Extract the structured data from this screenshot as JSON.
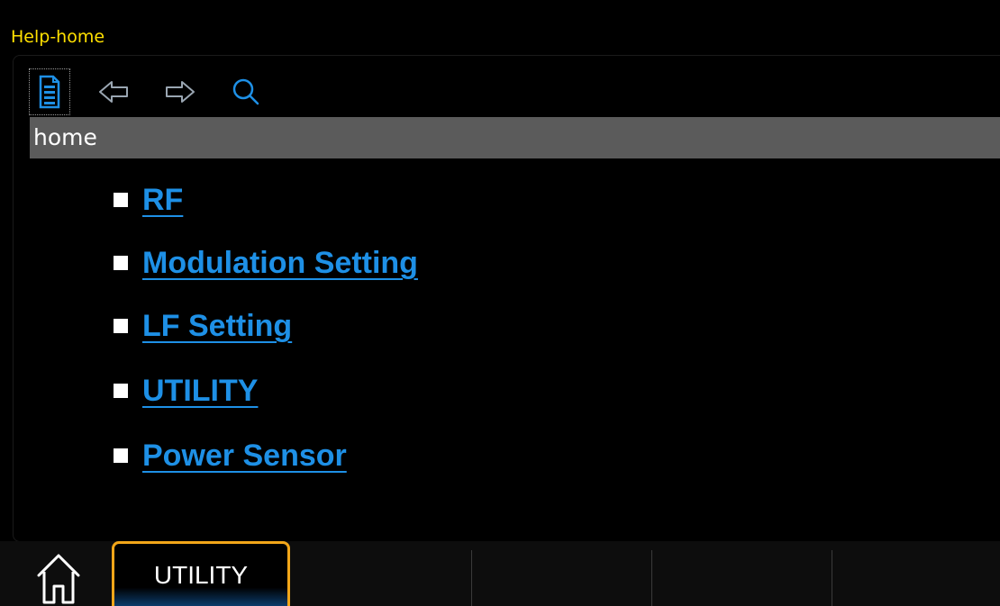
{
  "window": {
    "title": "Help-home"
  },
  "toolbar": {
    "buttons": [
      {
        "name": "contents",
        "icon": "document-list-icon"
      },
      {
        "name": "back",
        "icon": "back-arrow-icon"
      },
      {
        "name": "forward",
        "icon": "forward-arrow-icon"
      },
      {
        "name": "search",
        "icon": "search-icon"
      }
    ]
  },
  "breadcrumb": {
    "text": "home"
  },
  "topics": [
    {
      "label": "RF"
    },
    {
      "label": "Modulation Setting"
    },
    {
      "label": "LF Setting"
    },
    {
      "label": "UTILITY"
    },
    {
      "label": "Power Sensor"
    }
  ],
  "bottom_bar": {
    "home_icon": "home-icon",
    "softkeys": [
      {
        "label": "UTILITY",
        "active": true
      },
      {
        "label": ""
      },
      {
        "label": ""
      },
      {
        "label": ""
      }
    ]
  },
  "colors": {
    "title": "#ffe000",
    "link": "#1e90e6",
    "icon": "#1e90e6",
    "breadcrumb_bg": "#5b5b5b",
    "active_softkey_border": "#f2a619"
  }
}
